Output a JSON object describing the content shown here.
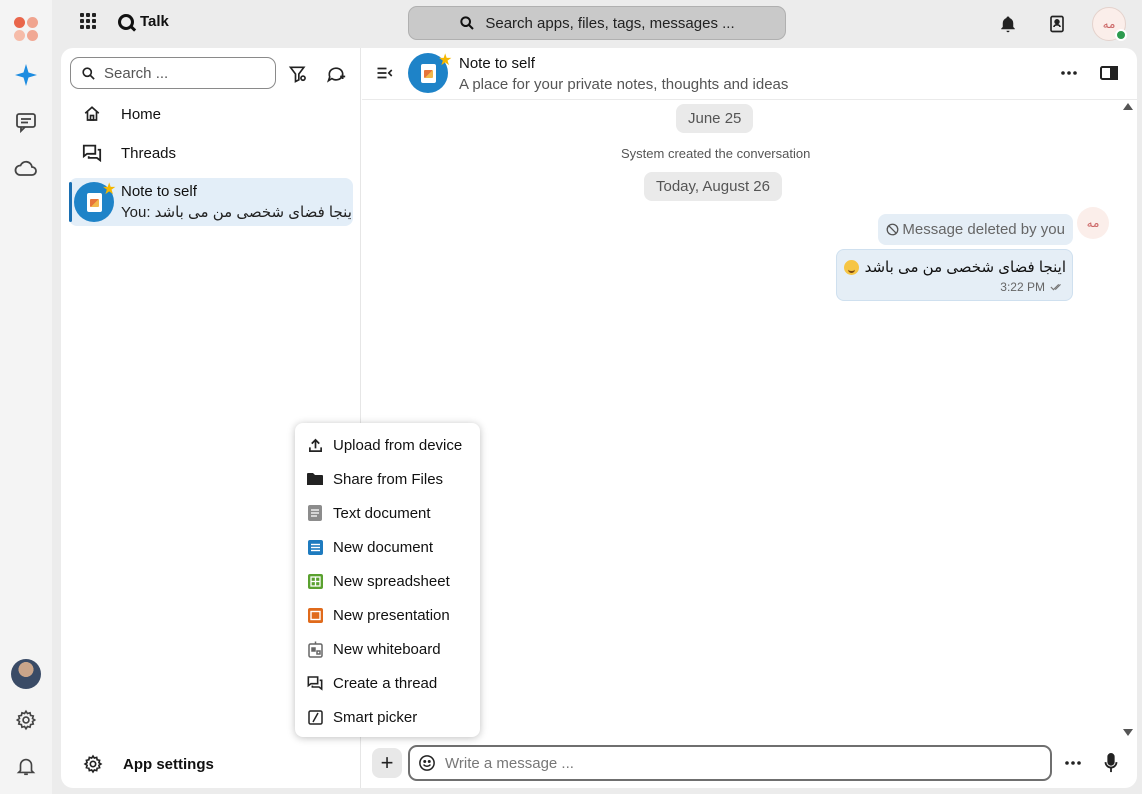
{
  "app": {
    "name": "Talk"
  },
  "top_search": {
    "placeholder": "Search apps, files, tags, messages ..."
  },
  "user": {
    "initials": "مه"
  },
  "sidebar": {
    "search_placeholder": "Search ...",
    "nav": [
      {
        "label": "Home",
        "icon": "home-icon"
      },
      {
        "label": "Threads",
        "icon": "threads-icon"
      }
    ],
    "conversation": {
      "title": "Note to self",
      "preview": "You: اینجا فضای شخصی من می باشد"
    },
    "app_settings": "App settings"
  },
  "chat": {
    "title": "Note to self",
    "subtitle": "A place for your private notes, thoughts and ideas",
    "date1": "June 25",
    "system_message": "System created the conversation",
    "date2": "Today, August 26",
    "deleted_message": "Message deleted by you",
    "message_text": "اینجا فضای شخصی من می باشد",
    "message_time": "3:22 PM",
    "composer_placeholder": "Write a message ..."
  },
  "attach_menu": [
    {
      "label": "Upload from device",
      "icon": "upload-icon"
    },
    {
      "label": "Share from Files",
      "icon": "folder-icon"
    },
    {
      "label": "Text document",
      "icon": "text-document-icon"
    },
    {
      "label": "New document",
      "icon": "document-icon",
      "color": "#1e7bbf"
    },
    {
      "label": "New spreadsheet",
      "icon": "spreadsheet-icon",
      "color": "#5aa12f"
    },
    {
      "label": "New presentation",
      "icon": "presentation-icon",
      "color": "#e06a1b"
    },
    {
      "label": "New whiteboard",
      "icon": "whiteboard-icon"
    },
    {
      "label": "Create a thread",
      "icon": "thread-icon"
    },
    {
      "label": "Smart picker",
      "icon": "smart-picker-icon"
    }
  ]
}
